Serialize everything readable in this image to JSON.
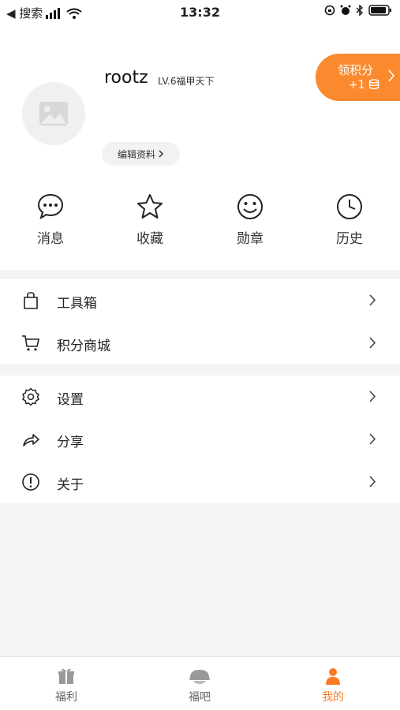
{
  "status_bar": {
    "back_label": "◀ 搜索",
    "time": "13:32"
  },
  "profile": {
    "username": "rootz",
    "level": "LV.6福甲天下",
    "edit_label": "编辑资料"
  },
  "points_button": {
    "label": "领积分",
    "bonus": "+1"
  },
  "quick_actions": [
    {
      "label": "消息",
      "icon": "chat-icon"
    },
    {
      "label": "收藏",
      "icon": "star-icon"
    },
    {
      "label": "勋章",
      "icon": "smile-icon"
    },
    {
      "label": "历史",
      "icon": "clock-icon"
    }
  ],
  "menu_group_1": [
    {
      "label": "工具箱",
      "icon": "bag-icon"
    },
    {
      "label": "积分商城",
      "icon": "cart-icon"
    }
  ],
  "menu_group_2": [
    {
      "label": "设置",
      "icon": "gear-icon"
    },
    {
      "label": "分享",
      "icon": "share-icon"
    },
    {
      "label": "关于",
      "icon": "info-icon"
    }
  ],
  "tabs": [
    {
      "label": "福利",
      "icon": "gift-icon",
      "active": false
    },
    {
      "label": "福吧",
      "icon": "bowl-icon",
      "active": false
    },
    {
      "label": "我的",
      "icon": "person-icon",
      "active": true
    }
  ],
  "colors": {
    "accent": "#fb8a2e",
    "tab_active": "#fb7a25"
  }
}
